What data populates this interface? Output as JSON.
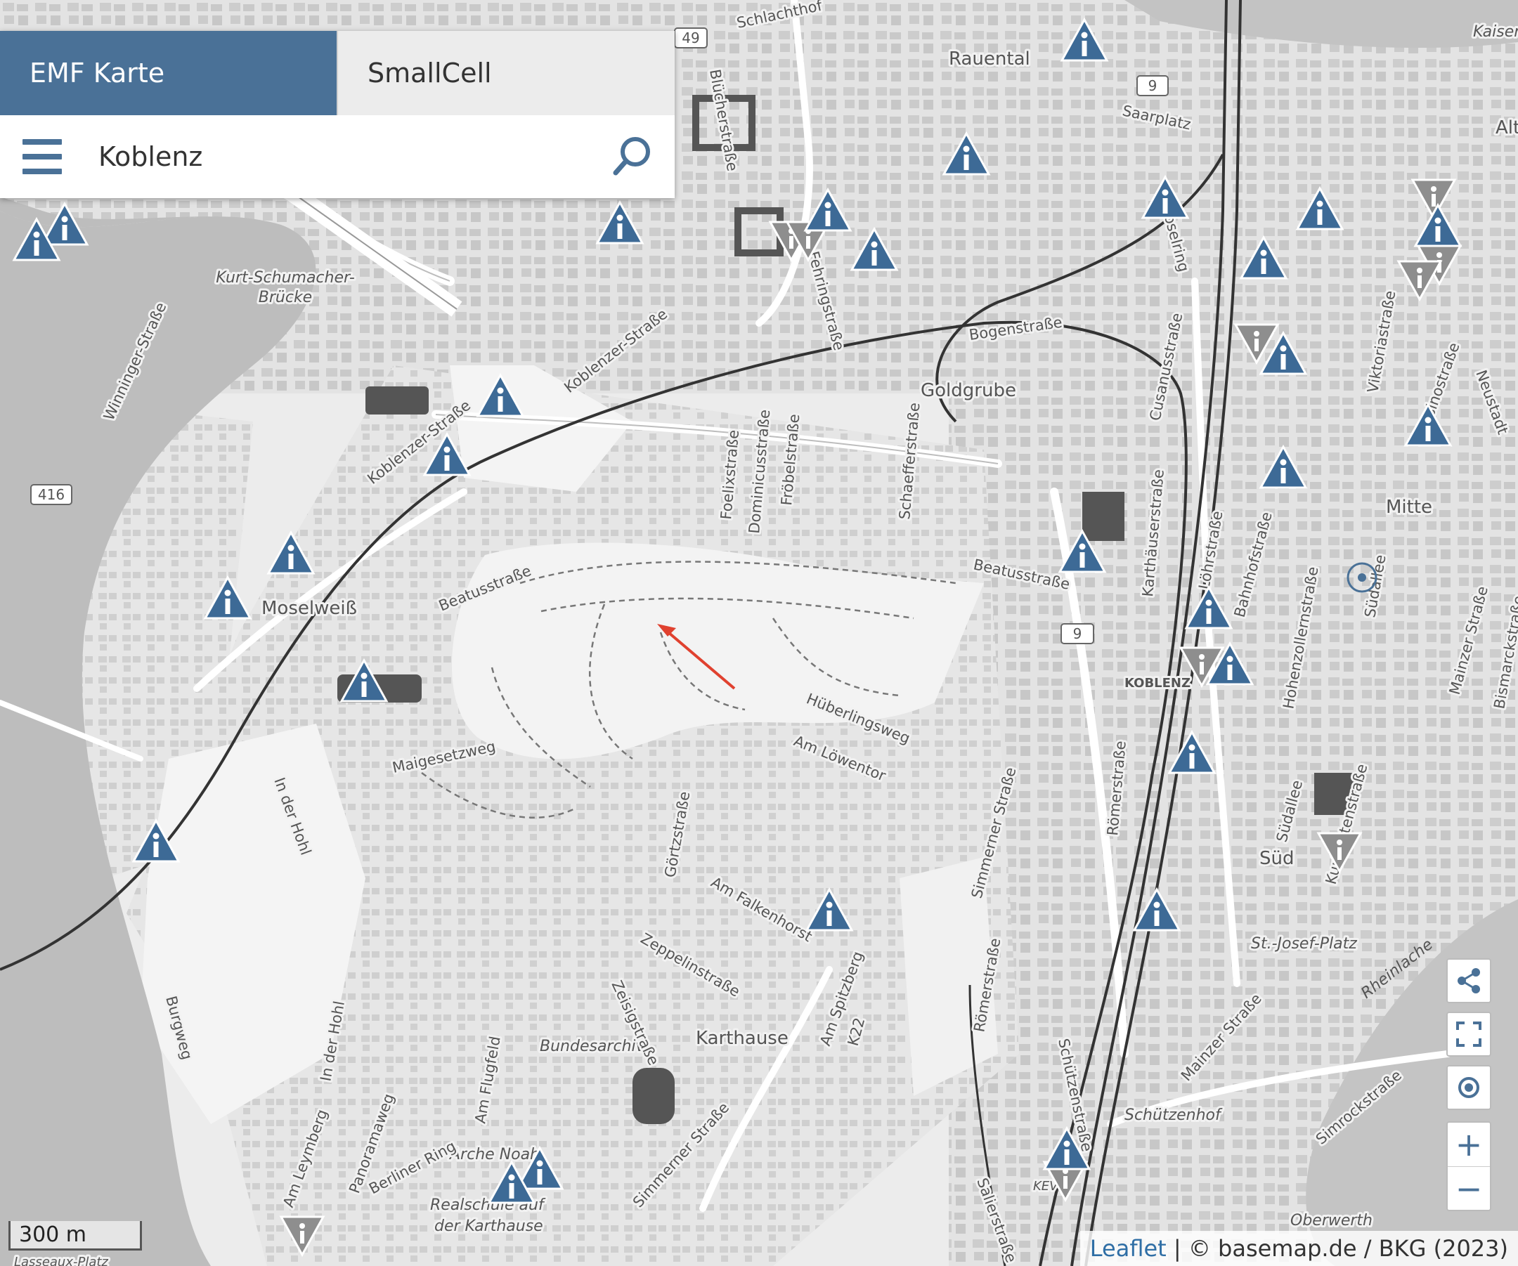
{
  "tabs": {
    "emf_label": "EMF Karte",
    "smallcell_label": "SmallCell"
  },
  "search": {
    "value": "Koblenz"
  },
  "map": {
    "places": {
      "raeuental": "Rauental",
      "goldgrube": "Goldgrube",
      "moselweiss": "Moselweiß",
      "mitte": "Mitte",
      "sued": "Süd",
      "karthause": "Karthause",
      "koblenz_station": "KOBLENZ",
      "kaiser": "Kaiser",
      "alts": "Alts"
    },
    "pois": {
      "bridge1": "Kurt-Schumacher-",
      "bridge2": "Brücke",
      "bundesarchiv": "Bundesarchiv",
      "archenoah": "Arche Noah",
      "realschule1": "Realschule auf",
      "realschule2": "der Karthause",
      "stjosef": "St.-Josef-Platz",
      "schuetzenhof": "Schützenhof",
      "oberwerth": "Oberwerth",
      "lasseaux": "Lasseaux-Platz",
      "rheinlache": "Rheinlache",
      "kev": "KEV"
    },
    "streets": {
      "schlachthof": "Schlachthof",
      "bluecher": "Blücherstraße",
      "saarplatz": "Saarplatz",
      "moselring": "Moselring",
      "bogen": "Bogenstraße",
      "cusanus": "Cusanusstraße",
      "viktoria": "Viktoriastraße",
      "casino": "Casinostraße",
      "neustadt": "Neustadt",
      "winninger": "Winninger-Straße",
      "koblenzer1": "Koblenzer-Straße",
      "koblenzer2": "Koblenzer-Straße",
      "fehring": "Fehringstraße",
      "foelix": "Foelixstraße",
      "dominicus": "Dominicusstraße",
      "froebel": "Fröbelstraße",
      "schaeffer": "Schaefferstraße",
      "beatus1": "Beatusstraße",
      "beatus2": "Beatusstraße",
      "karthaeuser": "Karthäuserstraße",
      "loehr": "Löhrstraße",
      "bahnhof": "Bahnhofstraße",
      "hohenzollern": "Hohenzollernstraße",
      "suedallee1": "Südallee",
      "suedallee2": "Südallee",
      "mainzer1": "Mainzer Straße",
      "mainzer2": "Mainzer Straße",
      "bismarck": "Bismarckstraße",
      "maigesetz": "Maigesetzweg",
      "inderhohl1": "In der Hohl",
      "inderhohl2": "In der Hohl",
      "hueberlings": "Hüberlingsweg",
      "amloewentor": "Am Löwentor",
      "goertz": "Görtzstraße",
      "amfalkenhorst": "Am Falkenhorst",
      "zeppelin": "Zeppelinstraße",
      "zeisig": "Zeisigstraße",
      "amspitzberg": "Am Spitzberg",
      "simmerner1": "Simmerner Straße",
      "simmerner2": "Simmerner Straße",
      "roemer1": "Römerstraße",
      "roemer2": "Römerstraße",
      "amflugfeld": "Am Flugfeld",
      "amleymberg": "Am Leymberg",
      "panoramaweg": "Panoramaweg",
      "berlinerring": "Berliner Ring",
      "burgweg": "Burgweg",
      "schuetzen": "Schützenstraße",
      "salier": "Salierstraße",
      "kurfuersten": "Kurfürstenstraße",
      "simrock": "Simrockstraße",
      "k22": "K22"
    },
    "shields": {
      "b49": "49",
      "b9a": "9",
      "b9b": "9",
      "b416": "416"
    },
    "colors": {
      "marker_blue": "#3d6a96",
      "marker_grey": "#8a8a8a",
      "arrow_red": "#e0412f"
    }
  },
  "scale": {
    "label": "300 m"
  },
  "attribution": {
    "link": "Leaflet",
    "text": "| © basemap.de / BKG (2023)"
  }
}
